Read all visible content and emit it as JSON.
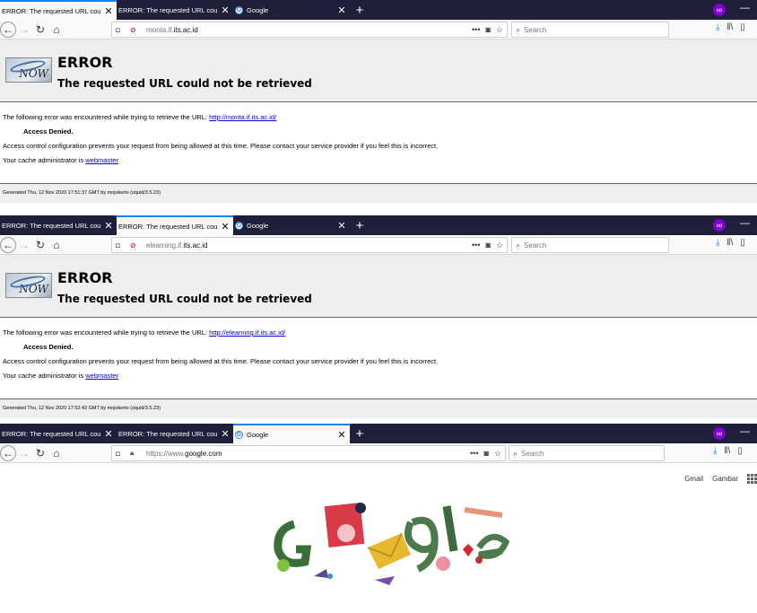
{
  "shots": [
    {
      "tabs": [
        {
          "label": "ERROR: The requested URL could n",
          "active": true
        },
        {
          "label": "ERROR: The requested URL could n",
          "active": false
        },
        {
          "label": "Google",
          "active": false
        }
      ],
      "url_prefix": "monta.if.",
      "url_domain": "its.ac.id",
      "search_placeholder": "Search",
      "error_title": "ERROR",
      "error_subtitle": "The requested URL could not be retrieved",
      "line1_text": "The following error was encountered while trying to retrieve the URL: ",
      "line1_link": "http://monta.if.its.ac.id/",
      "denied": "Access Denied.",
      "line2": "Access control configuration prevents your request from being allowed at this time. Please contact your service provider if you feel this is incorrect.",
      "line3_text": "Your cache administrator is ",
      "line3_link": "webmaster",
      "footer": "Generated Thu, 12 Nov 2020 17:51:37 GMT by mojokerto (squid/3.5.23)",
      "logo_text": "NOW"
    },
    {
      "tabs": [
        {
          "label": "ERROR: The requested URL could n",
          "active": false
        },
        {
          "label": "ERROR: The requested URL could n",
          "active": true
        },
        {
          "label": "Google",
          "active": false
        }
      ],
      "url_prefix": "elearning.if.",
      "url_domain": "its.ac.id",
      "search_placeholder": "Search",
      "error_title": "ERROR",
      "error_subtitle": "The requested URL could not be retrieved",
      "line1_text": "The following error was encountered while trying to retrieve the URL: ",
      "line1_link": "http://elearning.if.its.ac.id/",
      "denied": "Access Denied.",
      "line2": "Access control configuration prevents your request from being allowed at this time. Please contact your service provider if you feel this is incorrect.",
      "line3_text": "Your cache administrator is ",
      "line3_link": "webmaster",
      "footer": "Generated Thu, 12 Nov 2020 17:52:43 GMT by mojokerto (squid/3.5.23)",
      "logo_text": "NOW"
    },
    {
      "tabs": [
        {
          "label": "ERROR: The requested URL could n",
          "active": false
        },
        {
          "label": "ERROR: The requested URL could n",
          "active": false
        },
        {
          "label": "Google",
          "active": true
        }
      ],
      "url_prefix": "https://www.",
      "url_domain": "google.com",
      "search_placeholder": "Search",
      "links": {
        "gmail": "Gmail",
        "images": "Gambar"
      }
    }
  ],
  "icons": {
    "favicon": "G",
    "plus": "+",
    "close": "✕",
    "private": "∞",
    "minimize": "—"
  },
  "colors": {
    "tabbar": "#1f1f3a",
    "active_tab_border": "#0a84ff",
    "link": "#0000ee",
    "private": "#8000d7"
  }
}
